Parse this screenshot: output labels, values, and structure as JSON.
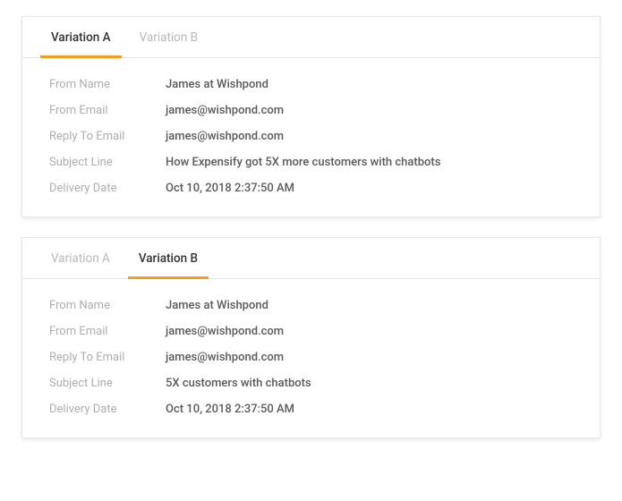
{
  "panels": [
    {
      "tabs": [
        {
          "label": "Variation A",
          "active": true
        },
        {
          "label": "Variation B",
          "active": false
        }
      ],
      "fields": {
        "from_name_label": "From Name",
        "from_name_value": "James at Wishpond",
        "from_email_label": "From Email",
        "from_email_value": "james@wishpond.com",
        "reply_to_label": "Reply To Email",
        "reply_to_value": "james@wishpond.com",
        "subject_label": "Subject Line",
        "subject_value": "How Expensify got 5X more customers with chatbots",
        "delivery_label": "Delivery Date",
        "delivery_value": "Oct 10, 2018 2:37:50 AM"
      }
    },
    {
      "tabs": [
        {
          "label": "Variation A",
          "active": false
        },
        {
          "label": "Variation B",
          "active": true
        }
      ],
      "fields": {
        "from_name_label": "From Name",
        "from_name_value": "James at Wishpond",
        "from_email_label": "From Email",
        "from_email_value": "james@wishpond.com",
        "reply_to_label": "Reply To Email",
        "reply_to_value": "james@wishpond.com",
        "subject_label": "Subject Line",
        "subject_value": "5X customers with chatbots",
        "delivery_label": "Delivery Date",
        "delivery_value": "Oct 10, 2018 2:37:50 AM"
      }
    }
  ]
}
